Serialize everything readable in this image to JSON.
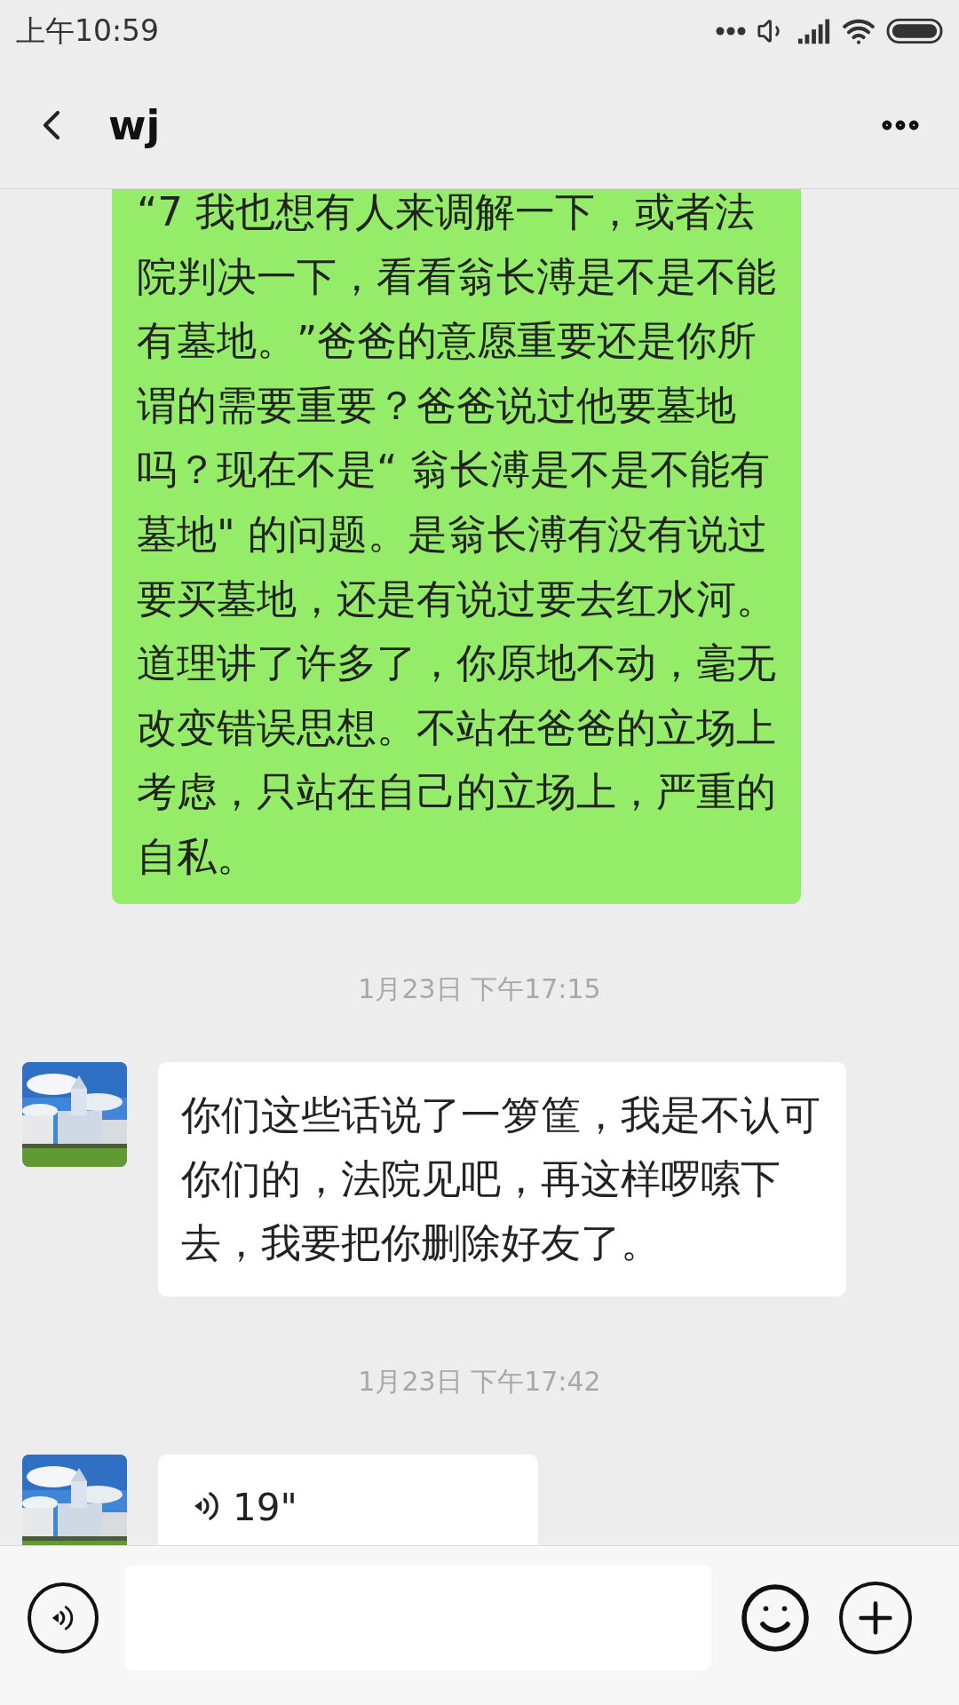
{
  "status_bar": {
    "time": "上午10:59"
  },
  "header": {
    "title": "wj"
  },
  "messages": [
    {
      "kind": "text",
      "outgoing": true,
      "text": "“7 我也想有人来调解一下，或者法院判决一下，看看翁长溥是不是不能有墓地。”爸爸的意愿重要还是你所谓的需要重要？爸爸说过他要墓地吗？现在不是“ 翁长溥是不是不能有墓地\" 的问题。是翁长溥有没有说过要买墓地，还是有说过要去红水河。道理讲了许多了，你原地不动，毫无改变错误思想。不站在爸爸的立场上考虑，只站在自己的立场上，严重的自私。"
    },
    {
      "kind": "timestamp",
      "text": "1月23日 下午17:15"
    },
    {
      "kind": "text",
      "outgoing": false,
      "text": "你们这些话说了一箩筐，我是不认可你们的，法院见吧，再这样啰嗦下去，我要把你删除好友了。"
    },
    {
      "kind": "timestamp",
      "text": "1月23日 下午17:42"
    },
    {
      "kind": "voice",
      "outgoing": false,
      "duration": "19\""
    }
  ]
}
